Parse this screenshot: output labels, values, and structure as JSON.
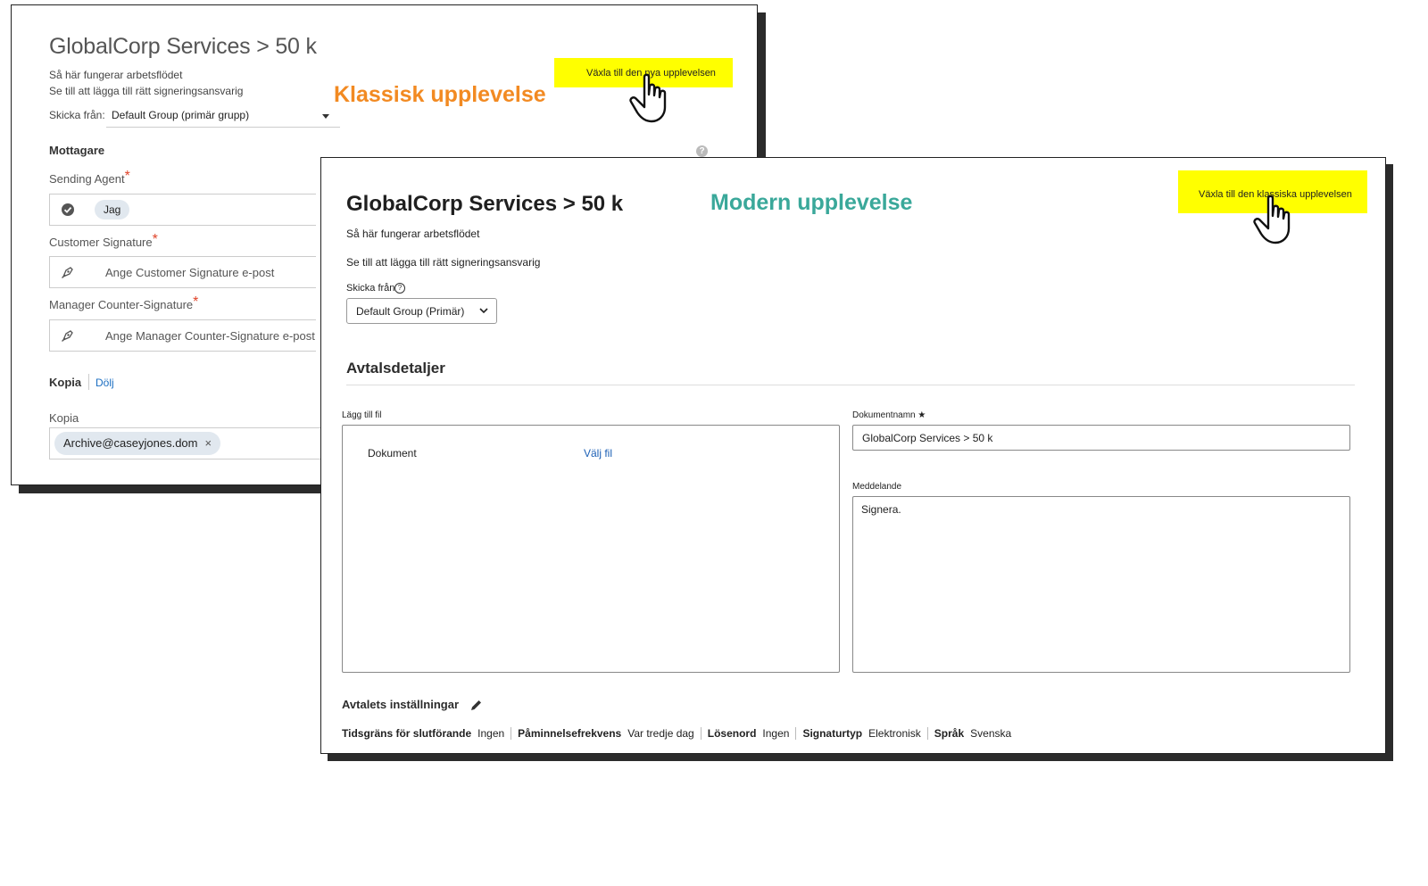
{
  "labels": {
    "classic": "Klassisk upplevelse",
    "modern": "Modern upplevelse"
  },
  "classic": {
    "title": "GlobalCorp Services > 50 k",
    "how_it_works": "Så här fungerar arbetsflödet",
    "hint": "Se till att lägga till rätt signeringsansvarig",
    "send_from_label": "Skicka från:",
    "send_from_value": "Default Group (primär grupp)",
    "switch_button": "Växla till den nya upplevelsen",
    "recipients_heading": "Mottagare",
    "help_icon": "?",
    "sending_agent_label": "Sending Agent",
    "sending_agent_value": "Jag",
    "customer_signature_label": "Customer Signature",
    "customer_signature_placeholder": "Ange Customer Signature e-post",
    "manager_label": "Manager Counter-Signature",
    "manager_placeholder": "Ange Manager Counter-Signature e-post",
    "required_mark": "*",
    "cc_heading": "Kopia",
    "hide_link": "Dölj",
    "cc_label": "Kopia",
    "cc_email": "Archive@caseyjones.dom",
    "cc_remove": "×"
  },
  "modern": {
    "title": "GlobalCorp Services > 50 k",
    "how_it_works": "Så här fungerar arbetsflödet",
    "hint": "Se till att lägga till rätt signeringsansvarig",
    "send_from_label": "Skicka från",
    "send_from_value": "Default Group (Primär)",
    "switch_button": "Växla till den klassiska upplevelsen",
    "section_title": "Avtalsdetaljer",
    "add_file_label": "Lägg till fil",
    "document_label": "Dokument",
    "choose_file": "Välj fil",
    "doc_name_label": "Dokumentnamn",
    "doc_name_required": "★",
    "doc_name_value": "GlobalCorp Services  >  50 k",
    "message_label": "Meddelande",
    "message_value": "Signera.",
    "settings_heading": "Avtalets inställningar",
    "settings": [
      {
        "key": "Tidsgräns för slutförande",
        "value": "Ingen"
      },
      {
        "key": "Påminnelsefrekvens",
        "value": "Var tredje dag"
      },
      {
        "key": "Lösenord",
        "value": "Ingen"
      },
      {
        "key": "Signaturtyp",
        "value": "Elektronisk"
      },
      {
        "key": "Språk",
        "value": "Svenska"
      }
    ]
  },
  "colors": {
    "highlight": "#ffff00",
    "classic_label": "#f28a22",
    "modern_label": "#3aa89a",
    "link": "#1b5fb5",
    "required": "#e0442a"
  },
  "icons": [
    "check-circle-icon",
    "pen-nib-icon",
    "chevron-down-icon",
    "help-icon",
    "pencil-icon",
    "hand-pointer-icon",
    "close-icon"
  ]
}
